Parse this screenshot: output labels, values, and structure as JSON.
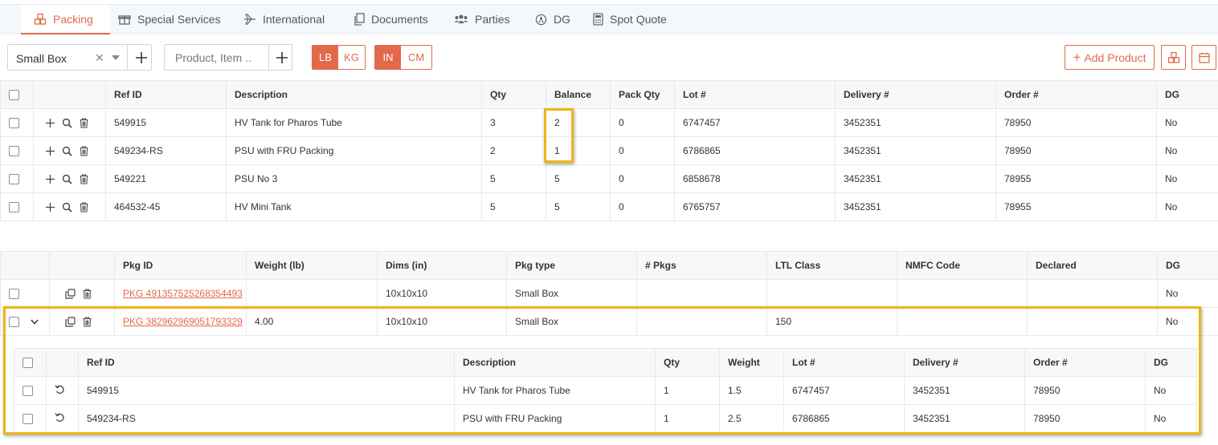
{
  "tabs": [
    {
      "label": "Packing",
      "icon": "boxes-icon",
      "active": true
    },
    {
      "label": "Special Services",
      "icon": "gift-icon"
    },
    {
      "label": "International",
      "icon": "plane-icon"
    },
    {
      "label": "Documents",
      "icon": "copy-icon"
    },
    {
      "label": "Parties",
      "icon": "people-icon"
    },
    {
      "label": "DG",
      "icon": "hazard-icon"
    },
    {
      "label": "Spot Quote",
      "icon": "calculator-icon"
    }
  ],
  "toolbar": {
    "package_select_value": "Small Box",
    "product_placeholder": "Product, Item ..",
    "weight_units": [
      "LB",
      "KG"
    ],
    "weight_unit_selected": "LB",
    "dim_units": [
      "IN",
      "CM"
    ],
    "dim_unit_selected": "IN",
    "add_product_label": "Add Product"
  },
  "products": {
    "headers": [
      "Ref ID",
      "Description",
      "Qty",
      "Balance",
      "Pack Qty",
      "Lot #",
      "Delivery #",
      "Order #",
      "DG"
    ],
    "rows": [
      {
        "ref": "549915",
        "desc": "HV Tank for Pharos Tube",
        "qty": "3",
        "balance": "2",
        "pack_qty": "0",
        "lot": "6747457",
        "delivery": "3452351",
        "order": "78950",
        "dg": "No"
      },
      {
        "ref": "549234-RS",
        "desc": "PSU with FRU Packing",
        "qty": "2",
        "balance": "1",
        "pack_qty": "0",
        "lot": "6786865",
        "delivery": "3452351",
        "order": "78950",
        "dg": "No"
      },
      {
        "ref": "549221",
        "desc": "PSU No 3",
        "qty": "5",
        "balance": "5",
        "pack_qty": "0",
        "lot": "6858678",
        "delivery": "3452351",
        "order": "78955",
        "dg": "No"
      },
      {
        "ref": "464532-45",
        "desc": "HV Mini Tank",
        "qty": "5",
        "balance": "5",
        "pack_qty": "0",
        "lot": "6765757",
        "delivery": "3452351",
        "order": "78955",
        "dg": "No"
      }
    ]
  },
  "packages": {
    "headers": [
      "Pkg ID",
      "Weight (lb)",
      "Dims (in)",
      "Pkg type",
      "# Pkgs",
      "LTL Class",
      "NMFC Code",
      "Declared",
      "DG"
    ],
    "rows": [
      {
        "pkg_id": "PKG 491357525268354493",
        "weight": "",
        "dims": "10x10x10",
        "type": "Small Box",
        "pkgs": "",
        "ltl": "",
        "nmfc": "",
        "declared": "",
        "dg": "No"
      },
      {
        "pkg_id": "PKG 382962969051793329",
        "weight": "4.00",
        "dims": "10x10x10",
        "type": "Small Box",
        "pkgs": "",
        "ltl": "150",
        "nmfc": "",
        "declared": "",
        "dg": "No"
      }
    ]
  },
  "package_items": {
    "headers": [
      "Ref ID",
      "Description",
      "Qty",
      "Weight",
      "Lot #",
      "Delivery #",
      "Order #",
      "DG"
    ],
    "rows": [
      {
        "ref": "549915",
        "desc": "HV Tank for Pharos Tube",
        "qty": "1",
        "weight": "1.5",
        "lot": "6747457",
        "delivery": "3452351",
        "order": "78950",
        "dg": "No"
      },
      {
        "ref": "549234-RS",
        "desc": "PSU with FRU Packing",
        "qty": "1",
        "weight": "2.5",
        "lot": "6786865",
        "delivery": "3452351",
        "order": "78950",
        "dg": "No"
      }
    ]
  },
  "colors": {
    "accent": "#e2694a",
    "highlight": "#f0b512"
  }
}
